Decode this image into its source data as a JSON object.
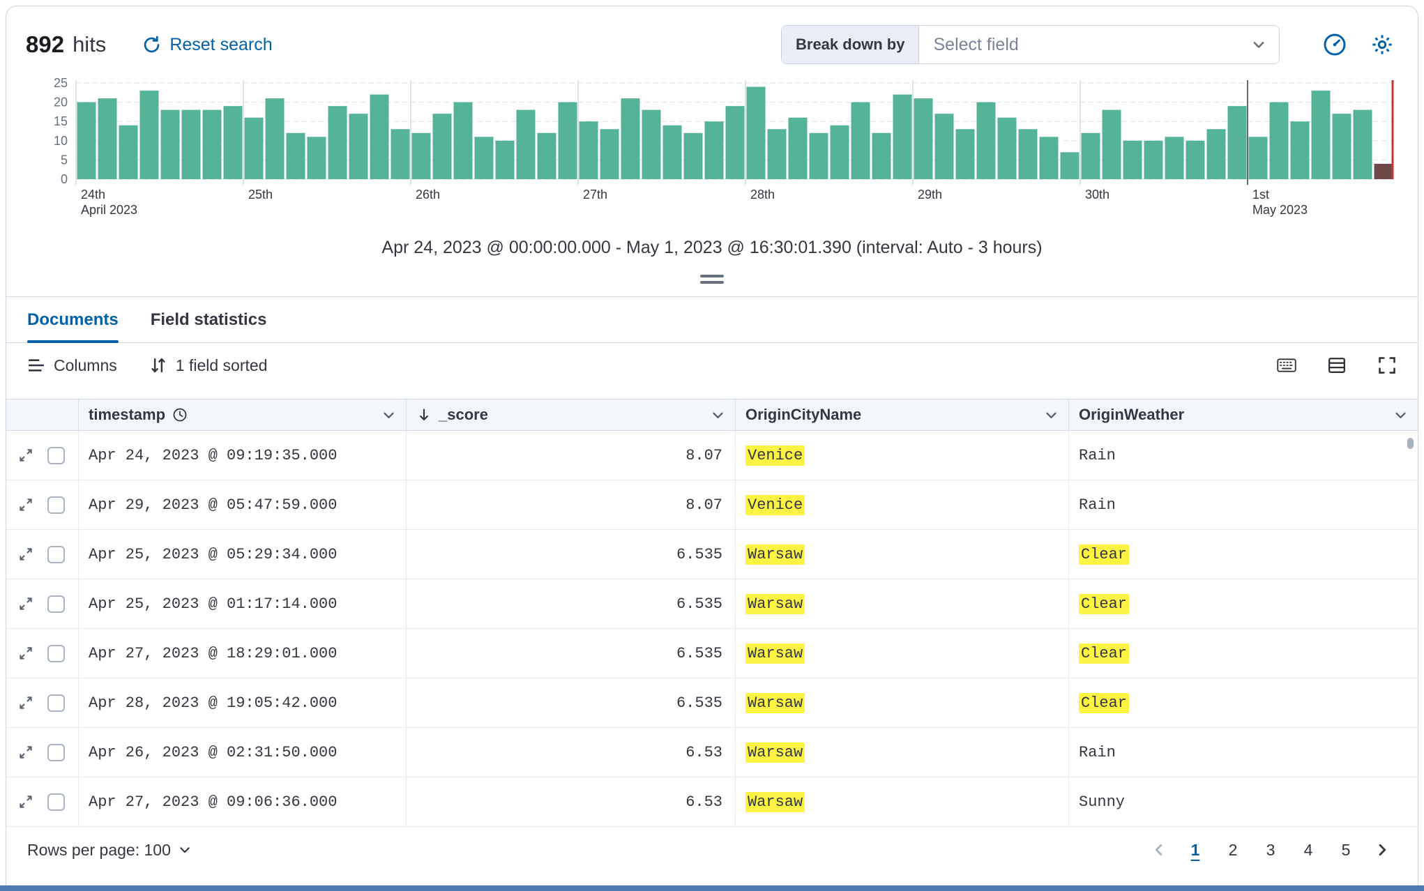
{
  "header": {
    "hits_count": "892",
    "hits_label": "hits",
    "reset_search_label": "Reset search",
    "breakdown_label": "Break down by",
    "breakdown_placeholder": "Select field"
  },
  "chart_data": {
    "type": "bar",
    "title": "",
    "xlabel": "",
    "ylabel": "",
    "ylim": [
      0,
      25
    ],
    "yticks": [
      0,
      5,
      10,
      15,
      20,
      25
    ],
    "grid": true,
    "interval_caption": "Apr 24, 2023 @ 00:00:00.000 - May 1, 2023 @ 16:30:01.390 (interval: Auto - 3 hours)",
    "values": [
      20,
      21,
      14,
      23,
      18,
      18,
      18,
      19,
      16,
      21,
      12,
      11,
      19,
      17,
      22,
      13,
      12,
      17,
      20,
      11,
      10,
      18,
      12,
      20,
      15,
      13,
      21,
      18,
      14,
      12,
      15,
      19,
      24,
      13,
      16,
      12,
      14,
      20,
      12,
      22,
      21,
      17,
      13,
      20,
      16,
      13,
      11,
      7,
      12,
      18,
      10,
      10,
      11,
      10,
      13,
      19,
      11,
      20,
      15,
      23,
      17,
      18,
      4
    ],
    "day_ticks": [
      {
        "index": 0,
        "line1": "24th",
        "line2": "April 2023"
      },
      {
        "index": 8,
        "line1": "25th",
        "line2": ""
      },
      {
        "index": 16,
        "line1": "26th",
        "line2": ""
      },
      {
        "index": 24,
        "line1": "27th",
        "line2": ""
      },
      {
        "index": 32,
        "line1": "28th",
        "line2": ""
      },
      {
        "index": 40,
        "line1": "29th",
        "line2": ""
      },
      {
        "index": 48,
        "line1": "30th",
        "line2": ""
      },
      {
        "index": 56,
        "line1": "1st",
        "line2": "May 2023"
      }
    ],
    "colors": {
      "bar": "#54B399",
      "current_bar": "#6E4747",
      "now_line": "#C4352F",
      "grid": "#D8DEE8",
      "day_line": "#C9D0DC",
      "strong_day_line": "#55585F",
      "axis_label": "#69707D",
      "tick_label": "#343741"
    }
  },
  "tabs": [
    {
      "label": "Documents",
      "active": true
    },
    {
      "label": "Field statistics",
      "active": false
    }
  ],
  "toolbar": {
    "columns_label": "Columns",
    "sorted_label": "1 field sorted"
  },
  "table": {
    "columns": {
      "timestamp": "timestamp",
      "score": "_score",
      "city": "OriginCityName",
      "weather": "OriginWeather"
    },
    "rows": [
      {
        "timestamp": "Apr 24, 2023 @ 09:19:35.000",
        "score": "8.07",
        "city": "Venice",
        "city_hl": true,
        "weather": "Rain",
        "weather_hl": false
      },
      {
        "timestamp": "Apr 29, 2023 @ 05:47:59.000",
        "score": "8.07",
        "city": "Venice",
        "city_hl": true,
        "weather": "Rain",
        "weather_hl": false
      },
      {
        "timestamp": "Apr 25, 2023 @ 05:29:34.000",
        "score": "6.535",
        "city": "Warsaw",
        "city_hl": true,
        "weather": "Clear",
        "weather_hl": true
      },
      {
        "timestamp": "Apr 25, 2023 @ 01:17:14.000",
        "score": "6.535",
        "city": "Warsaw",
        "city_hl": true,
        "weather": "Clear",
        "weather_hl": true
      },
      {
        "timestamp": "Apr 27, 2023 @ 18:29:01.000",
        "score": "6.535",
        "city": "Warsaw",
        "city_hl": true,
        "weather": "Clear",
        "weather_hl": true
      },
      {
        "timestamp": "Apr 28, 2023 @ 19:05:42.000",
        "score": "6.535",
        "city": "Warsaw",
        "city_hl": true,
        "weather": "Clear",
        "weather_hl": true
      },
      {
        "timestamp": "Apr 26, 2023 @ 02:31:50.000",
        "score": "6.53",
        "city": "Warsaw",
        "city_hl": true,
        "weather": "Rain",
        "weather_hl": false
      },
      {
        "timestamp": "Apr 27, 2023 @ 09:06:36.000",
        "score": "6.53",
        "city": "Warsaw",
        "city_hl": true,
        "weather": "Sunny",
        "weather_hl": false
      }
    ]
  },
  "footer": {
    "rows_per_page_label": "Rows per page: 100",
    "pages": [
      "1",
      "2",
      "3",
      "4",
      "5"
    ],
    "active_page": "1"
  },
  "colors": {
    "accent": "#0061A6",
    "highlight": "#FCF342"
  }
}
